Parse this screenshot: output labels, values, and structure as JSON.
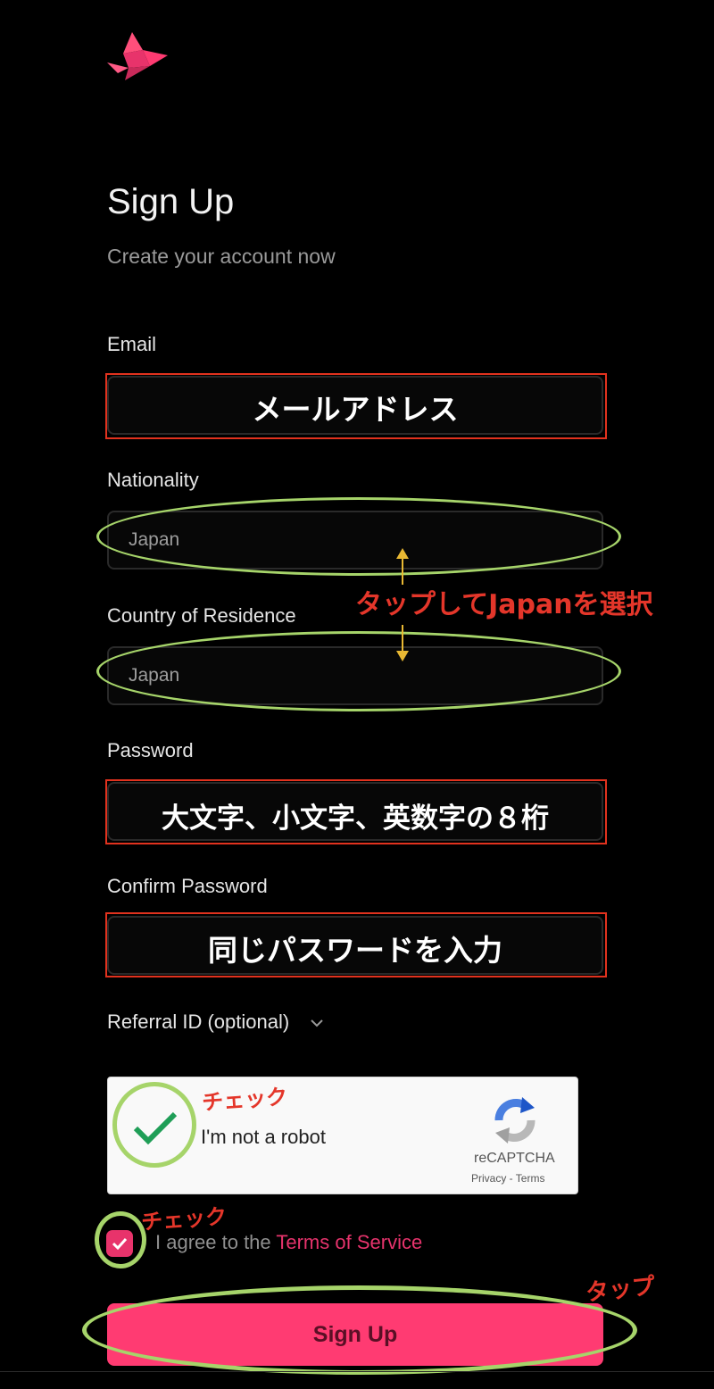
{
  "header": {
    "logo": "dragon-logo-icon"
  },
  "page": {
    "title": "Sign Up",
    "subtitle": "Create your account now"
  },
  "form": {
    "email": {
      "label": "Email",
      "note": "メールアドレス"
    },
    "nationality": {
      "label": "Nationality",
      "value": "Japan"
    },
    "residence": {
      "label": "Country of Residence",
      "value": "Japan"
    },
    "password": {
      "label": "Password",
      "note": "大文字、小文字、英数字の８桁"
    },
    "confirm_password": {
      "label": "Confirm Password",
      "note": "同じパスワードを入力"
    },
    "referral": {
      "label": "Referral ID (optional)"
    }
  },
  "annotations": {
    "tap_select": "タップしてJapanを選択",
    "check1": "チェック",
    "check2": "チェック",
    "tap": "タップ"
  },
  "captcha": {
    "text": "I'm not a robot",
    "brand": "reCAPTCHA",
    "links": "Privacy - Terms"
  },
  "terms": {
    "prefix": "I agree to the",
    "link": "Terms of Service"
  },
  "submit": {
    "label": "Sign Up"
  },
  "colors": {
    "accent": "#ff3b72",
    "annotation_red": "#e4362a",
    "annotation_green": "#a6d46a",
    "annotation_arrow": "#e8b833"
  }
}
